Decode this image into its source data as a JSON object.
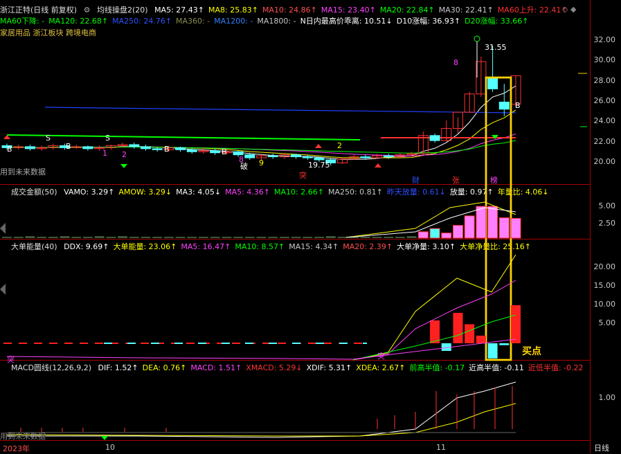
{
  "colors": {
    "bg": "#000000",
    "up": "#ff3232",
    "down": "#54ffff",
    "ma5": "#ffffff",
    "ma10": "#ffff00",
    "ma20": "#ff00ff",
    "ma60": "#00ff00",
    "ma120": "#0000ff",
    "grid": "#aa0000",
    "yellow_box": "#ffd400",
    "buy": "#ffd400"
  },
  "main_header": {
    "title": "浙江正特(日线 前复权)",
    "indicator": "均线操盘2(20)",
    "items": [
      {
        "label": "MA5: 27.43",
        "color": "#ffffff",
        "arrow": "↑"
      },
      {
        "label": "MA8: 25.83",
        "color": "#ffff00",
        "arrow": "↑"
      },
      {
        "label": "MA10: 24.86",
        "color": "#ff5050",
        "arrow": "↑"
      },
      {
        "label": "MA15: 23.40",
        "color": "#ff40ff",
        "arrow": "↑"
      },
      {
        "label": "MA20: 22.84",
        "color": "#00ff00",
        "arrow": "↑"
      },
      {
        "label": "MA30: 22.41",
        "color": "#c8c8c8",
        "arrow": "↑"
      },
      {
        "label": "MA60上升: 22.41",
        "color": "#ff3232",
        "arrow": "↑"
      }
    ],
    "items2": [
      {
        "label": "MA60下降: -",
        "color": "#00ff00"
      },
      {
        "label": "MA120: 22.68",
        "color": "#00ff00",
        "arrow": "↑"
      },
      {
        "label": "MA250: 24.76",
        "color": "#3050ff",
        "arrow": "↑"
      },
      {
        "label": "MA360: -",
        "color": "#8c8c50"
      },
      {
        "label": "MA1200: -",
        "color": "#3080ff"
      },
      {
        "label": "MA1800: -",
        "color": "#c8c8c8"
      },
      {
        "label": "N日内最高价乖离: 10.51",
        "color": "#ffffff",
        "arrow": "↓"
      },
      {
        "label": "D10涨幅: 36.93",
        "color": "#ffffff",
        "arrow": "↑"
      },
      {
        "label": "D20涨幅: 33.66",
        "color": "#00ff00",
        "arrow": "↑"
      }
    ],
    "sector": "家居用品 浙江板块 跨境电商"
  },
  "price_axis": [
    "32.00",
    "30.00",
    "28.00",
    "26.00",
    "24.00",
    "22.00",
    "20.00"
  ],
  "vol_axis": [
    "5.00",
    "2.50"
  ],
  "ddx_axis": [
    "20.00",
    "15.00",
    "10.00",
    "5.00"
  ],
  "macd_axis": [
    "1.00"
  ],
  "vol_header": {
    "title": "成交金额(50)",
    "items": [
      {
        "label": "VAMO: 3.29",
        "color": "#ffffff",
        "arrow": "↑"
      },
      {
        "label": "AMOW: 3.29",
        "color": "#ffff00",
        "arrow": "↓"
      },
      {
        "label": "MA3: 4.05",
        "color": "#ffffff",
        "arrow": "↓"
      },
      {
        "label": "MA5: 4.36",
        "color": "#ff40ff",
        "arrow": "↑"
      },
      {
        "label": "MA10: 2.66",
        "color": "#00ff00",
        "arrow": "↑"
      },
      {
        "label": "MA250: 0.81",
        "color": "#c8c8c8",
        "arrow": "↑"
      },
      {
        "label": "昨天放量: 0.61",
        "color": "#3050ff",
        "arrow": "↓"
      },
      {
        "label": "放量: 0.97",
        "color": "#ffffff",
        "arrow": "↑"
      },
      {
        "label": "年量比: 4.06",
        "color": "#ffff00",
        "arrow": "↓"
      }
    ]
  },
  "ddx_header": {
    "title": "大单能量(40)",
    "items": [
      {
        "label": "DDX: 9.69",
        "color": "#ffffff",
        "arrow": "↑"
      },
      {
        "label": "大单能量: 23.06",
        "color": "#ffff00",
        "arrow": "↑"
      },
      {
        "label": "MA5: 16.47",
        "color": "#ff40ff",
        "arrow": "↑"
      },
      {
        "label": "MA10: 8.57",
        "color": "#00ff00",
        "arrow": "↑"
      },
      {
        "label": "MA15: 4.34",
        "color": "#c8c8c8",
        "arrow": "↑"
      },
      {
        "label": "MA20: 2.39",
        "color": "#ff5050",
        "arrow": "↑"
      },
      {
        "label": "大单净量: 3.10",
        "color": "#ffffff",
        "arrow": "↑"
      },
      {
        "label": "大单净量比: 25.16",
        "color": "#ffff00",
        "arrow": "↑"
      }
    ]
  },
  "macd_header": {
    "title": "MACD圆线(12,26,9,2)",
    "items": [
      {
        "label": "DIF: 1.52",
        "color": "#ffffff",
        "arrow": "↑"
      },
      {
        "label": "DEA: 0.76",
        "color": "#ffff00",
        "arrow": "↑"
      },
      {
        "label": "MACD: 1.51",
        "color": "#ff40ff",
        "arrow": "↑"
      },
      {
        "label": "XMACD: 5.29",
        "color": "#ff3232",
        "arrow": "↓"
      },
      {
        "label": "XDIF: 5.31",
        "color": "#ffffff",
        "arrow": "↑"
      },
      {
        "label": "XDEA: 2.67",
        "color": "#ffff00",
        "arrow": "↑"
      },
      {
        "label": "前高半值: -0.17",
        "color": "#00ff00",
        "arrow": ""
      },
      {
        "label": "近高半值: -0.11",
        "color": "#ffffff",
        "arrow": ""
      },
      {
        "label": "近低半值: -0.22",
        "color": "#ff3232",
        "arrow": ""
      }
    ]
  },
  "labels": {
    "future_data": "用到未来数据",
    "future_data2": "用到未来数据",
    "price_high": "31.55",
    "price_low": "19.75",
    "buy_point": "买点",
    "tag_cai": "财",
    "tag_zhang": "张",
    "tag_bang": "榜",
    "tag_po": "破",
    "year": "2023年",
    "month10": "10",
    "month11": "11",
    "period": "日线",
    "n1": "1",
    "n2": "2",
    "n2b": "2",
    "n8": "8",
    "n9": "9",
    "n8b": "8",
    "letter_s": "S",
    "letter_b": "B",
    "tu_char": "突"
  },
  "chart_data": {
    "type": "candlestick",
    "price_range": [
      19.0,
      33.0
    ],
    "candles": [
      {
        "o": 21.7,
        "c": 21.5,
        "h": 21.9,
        "l": 21.3
      },
      {
        "o": 21.5,
        "c": 21.6,
        "h": 21.8,
        "l": 21.3
      },
      {
        "o": 21.6,
        "c": 21.4,
        "h": 21.8,
        "l": 21.2
      },
      {
        "o": 21.4,
        "c": 21.5,
        "h": 21.7,
        "l": 21.2
      },
      {
        "o": 21.5,
        "c": 21.7,
        "h": 21.9,
        "l": 21.3
      },
      {
        "o": 21.7,
        "c": 21.5,
        "h": 21.9,
        "l": 21.3
      },
      {
        "o": 21.5,
        "c": 21.6,
        "h": 21.8,
        "l": 21.4
      },
      {
        "o": 21.6,
        "c": 21.4,
        "h": 21.7,
        "l": 21.2
      },
      {
        "o": 21.4,
        "c": 21.5,
        "h": 21.7,
        "l": 21.2
      },
      {
        "o": 21.5,
        "c": 21.7,
        "h": 21.8,
        "l": 21.3
      },
      {
        "o": 21.7,
        "c": 21.8,
        "h": 22.0,
        "l": 21.5
      },
      {
        "o": 21.8,
        "c": 21.6,
        "h": 22.0,
        "l": 21.4
      },
      {
        "o": 21.6,
        "c": 21.4,
        "h": 21.8,
        "l": 21.2
      },
      {
        "o": 21.4,
        "c": 21.3,
        "h": 21.6,
        "l": 21.1
      },
      {
        "o": 21.3,
        "c": 21.5,
        "h": 21.7,
        "l": 21.1
      },
      {
        "o": 21.5,
        "c": 21.3,
        "h": 21.6,
        "l": 21.1
      },
      {
        "o": 21.3,
        "c": 21.1,
        "h": 21.5,
        "l": 20.9
      },
      {
        "o": 21.1,
        "c": 21.2,
        "h": 21.4,
        "l": 20.9
      },
      {
        "o": 21.2,
        "c": 21.0,
        "h": 21.4,
        "l": 20.8
      },
      {
        "o": 21.0,
        "c": 21.1,
        "h": 21.3,
        "l": 20.8
      },
      {
        "o": 21.1,
        "c": 20.8,
        "h": 21.2,
        "l": 20.6
      },
      {
        "o": 20.8,
        "c": 20.5,
        "h": 21.0,
        "l": 20.3
      },
      {
        "o": 20.5,
        "c": 20.7,
        "h": 20.9,
        "l": 20.3
      },
      {
        "o": 20.7,
        "c": 20.6,
        "h": 20.9,
        "l": 20.4
      },
      {
        "o": 20.6,
        "c": 20.8,
        "h": 21.0,
        "l": 20.4
      },
      {
        "o": 20.8,
        "c": 20.6,
        "h": 20.9,
        "l": 20.4
      },
      {
        "o": 20.6,
        "c": 20.5,
        "h": 20.8,
        "l": 20.3
      },
      {
        "o": 20.5,
        "c": 20.3,
        "h": 20.6,
        "l": 20.1
      },
      {
        "o": 20.3,
        "c": 20.0,
        "h": 20.5,
        "l": 19.75
      },
      {
        "o": 20.0,
        "c": 20.4,
        "h": 20.6,
        "l": 19.9
      },
      {
        "o": 20.4,
        "c": 20.6,
        "h": 20.8,
        "l": 20.3
      },
      {
        "o": 20.6,
        "c": 20.5,
        "h": 20.8,
        "l": 20.3
      },
      {
        "o": 20.5,
        "c": 20.7,
        "h": 20.9,
        "l": 20.4
      },
      {
        "o": 20.7,
        "c": 20.6,
        "h": 20.9,
        "l": 20.4
      },
      {
        "o": 20.6,
        "c": 20.8,
        "h": 21.0,
        "l": 20.5
      },
      {
        "o": 20.8,
        "c": 20.9,
        "h": 21.1,
        "l": 20.6
      },
      {
        "o": 20.9,
        "c": 22.7,
        "h": 23.1,
        "l": 20.8
      },
      {
        "o": 22.7,
        "c": 22.2,
        "h": 22.9,
        "l": 22.0
      },
      {
        "o": 22.2,
        "c": 23.4,
        "h": 24.2,
        "l": 22.1
      },
      {
        "o": 23.4,
        "c": 25.0,
        "h": 24.5,
        "l": 22.9
      },
      {
        "o": 25.0,
        "c": 26.8,
        "h": 27.0,
        "l": 25.0
      },
      {
        "o": 26.8,
        "c": 30.0,
        "h": 30.5,
        "l": 26.5
      },
      {
        "o": 28.4,
        "c": 27.3,
        "h": 31.55,
        "l": 27.0
      },
      {
        "o": 26.0,
        "c": 25.3,
        "h": 27.8,
        "l": 24.6
      },
      {
        "o": 25.8,
        "c": 28.6,
        "h": 28.6,
        "l": 25.6
      }
    ]
  }
}
